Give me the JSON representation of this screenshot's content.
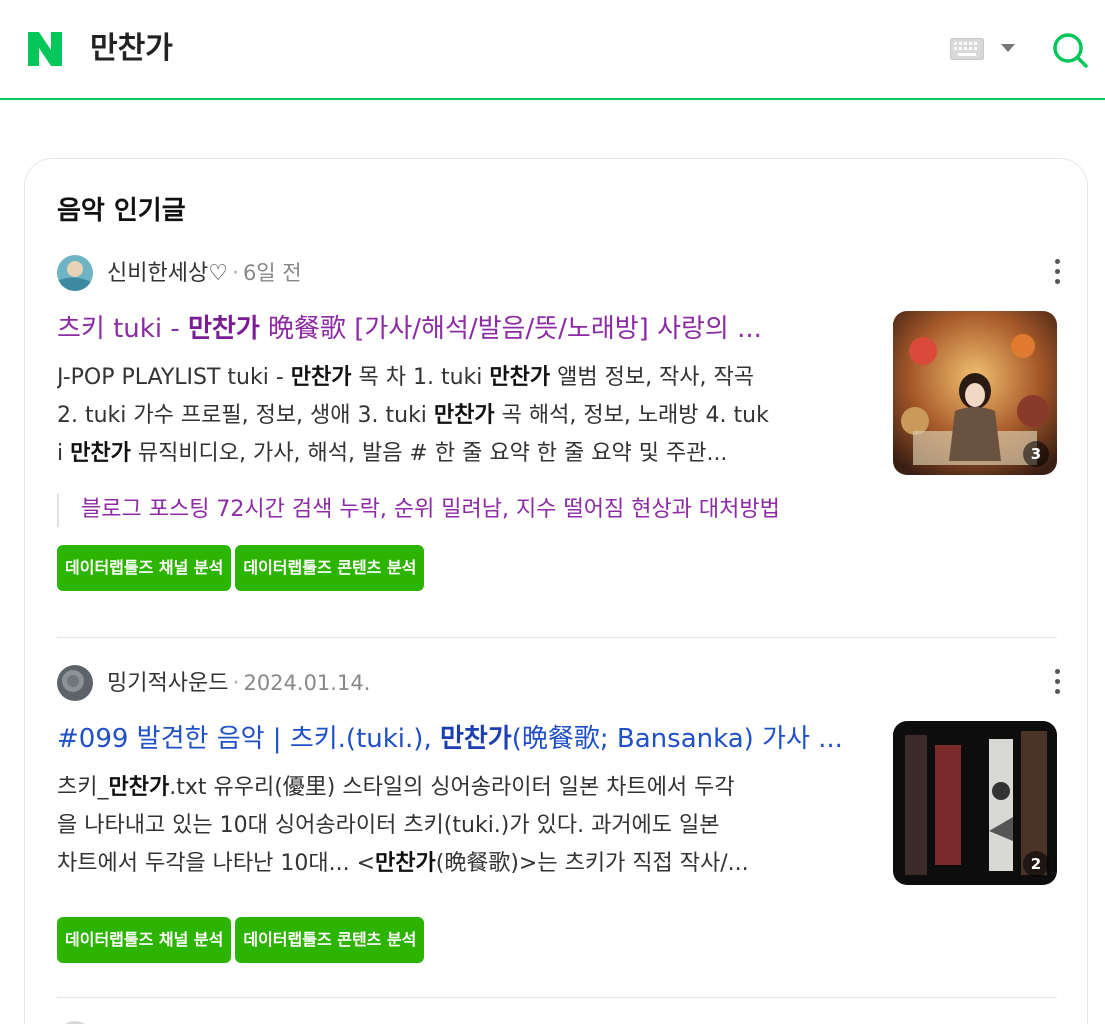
{
  "header": {
    "query": "만찬가",
    "logo": "naver-n-logo",
    "keyboard_icon": "keyboard-icon",
    "search_icon": "search-icon",
    "accent_color": "#03c75a"
  },
  "section": {
    "title": "음악 인기글"
  },
  "posts": [
    {
      "author": "신비한세상♡",
      "date": "6일 전",
      "title_pre": "츠키 tuki - ",
      "title_bold": "만찬가",
      "title_post": " 晩餐歌 [가사/해석/발음/뜻/노래방] 사랑의 ...",
      "desc_lines": [
        {
          "a": "J-POP PLAYLIST tuki - ",
          "b": "만찬가",
          "c": " 목 차 1. tuki ",
          "d": "만찬가",
          "e": " 앨범 정보, 작사, 작곡"
        },
        {
          "a": "2. tuki 가수 프로필, 정보, 생애 3. tuki ",
          "b": "만찬가",
          "c": " 곡 해석, 정보, 노래방 4. tuk",
          "d": "",
          "e": ""
        },
        {
          "a": "i ",
          "b": "만찬가",
          "c": " 뮤직비디오, 가사, 해석, 발음 # 한 줄 요약 한 줄 요약 및 주관...",
          "d": "",
          "e": ""
        }
      ],
      "related": "블로그 포스팅 72시간 검색 누락, 순위 밀려남, 지수 떨어짐 현상과 대처방법",
      "tags": [
        "데이터랩툴즈 채널 분석",
        "데이터랩툴즈 콘텐츠 분석"
      ],
      "image_count": "3"
    },
    {
      "author": "밍기적사운드",
      "date": "2024.01.14.",
      "title_pre": "#099 발견한 음악 | 츠키.(tuki.), ",
      "title_bold": "만찬가",
      "title_post": "(晩餐歌; Bansanka) 가사 ...",
      "desc_lines": [
        {
          "a": "츠키_",
          "b": "만찬가",
          "c": ".txt 유우리(優里) 스타일의 싱어송라이터 일본 차트에서 두각",
          "d": "",
          "e": ""
        },
        {
          "a": "을 나타내고 있는 10대 싱어송라이터 츠키(tuki.)가 있다. 과거에도 일본",
          "b": "",
          "c": "",
          "d": "",
          "e": ""
        },
        {
          "a": "차트에서 두각을 나타난 10대... <",
          "b": "만찬가",
          "c": "(晩餐歌)>는 츠키가 직접 작사/...",
          "d": "",
          "e": ""
        }
      ],
      "tags": [
        "데이터랩툴즈 채널 분석",
        "데이터랩툴즈 콘텐츠 분석"
      ],
      "image_count": "2"
    }
  ]
}
